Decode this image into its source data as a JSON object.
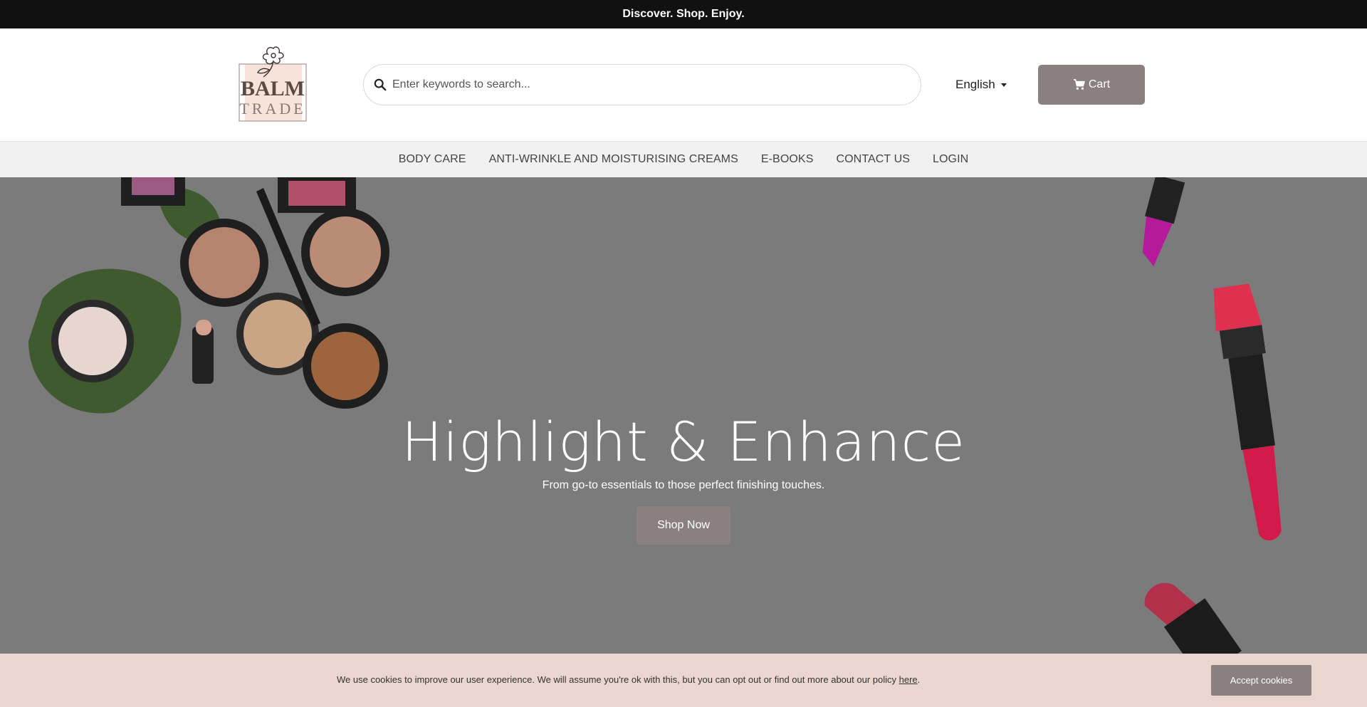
{
  "topbar": {
    "text": "Discover. Shop. Enjoy."
  },
  "header": {
    "logo": {
      "line1": "BALM",
      "line2": "TRADE"
    },
    "search": {
      "placeholder": "Enter keywords to search...",
      "value": ""
    },
    "language": "English",
    "cart_label": "Cart"
  },
  "nav": {
    "items": [
      {
        "label": "BODY CARE"
      },
      {
        "label": "ANTI-WRINKLE AND MOISTURISING CREAMS"
      },
      {
        "label": "E-BOOKS"
      },
      {
        "label": "CONTACT US"
      },
      {
        "label": "LOGIN"
      }
    ]
  },
  "hero": {
    "title": "Highlight & Enhance",
    "subtitle": "From go-to essentials to those perfect finishing touches.",
    "button": "Shop Now"
  },
  "cookie": {
    "text": "We use cookies to improve our user experience. We will assume you're ok with this, but you can opt out or find out more about our policy ",
    "link": "here",
    "after": ".",
    "button": "Accept cookies"
  },
  "colors": {
    "topbar_bg": "#111111",
    "accent": "#8a8080",
    "nav_bg": "#f1f1f1",
    "hero_bg": "#7b7b7b",
    "cookie_bg": "#ead6ce"
  },
  "icons": [
    "search-icon",
    "cart-icon",
    "chevron-down-icon",
    "flower-logo"
  ]
}
